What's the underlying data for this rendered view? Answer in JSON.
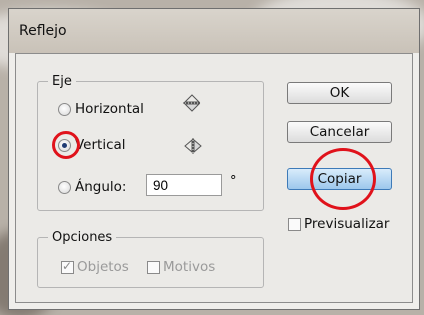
{
  "dialog": {
    "title": "Reflejo"
  },
  "axis_group": {
    "legend": "Eje",
    "horizontal_label": "Horizontal",
    "vertical_label": "Vertical",
    "angle_label": "Ángulo:",
    "angle_value": "90",
    "degree_symbol": "°",
    "selected": "vertical"
  },
  "options_group": {
    "legend": "Opciones",
    "objects_label": "Objetos",
    "objects_checked": true,
    "patterns_label": "Motivos",
    "patterns_checked": false
  },
  "buttons": {
    "ok": "OK",
    "cancel": "Cancelar",
    "copy": "Copiar"
  },
  "preview": {
    "label": "Previsualizar",
    "checked": false
  },
  "icons": {
    "horizontal": "reflect-horizontal-icon",
    "vertical": "reflect-vertical-icon"
  },
  "colors": {
    "highlight_ring": "#e0121b",
    "primary_button": "#9cc7ec"
  }
}
